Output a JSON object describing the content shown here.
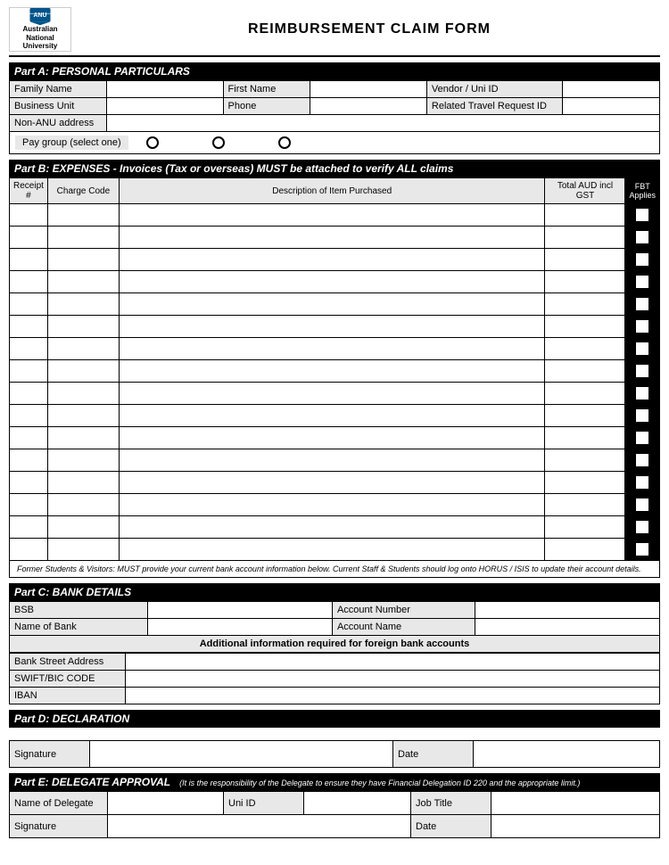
{
  "header": {
    "logo_name": "Australian National University",
    "title": "REIMBURSEMENT CLAIM FORM"
  },
  "part_a": {
    "heading": "Part A: PERSONAL PARTICULARS",
    "fields": {
      "family_name_label": "Family Name",
      "first_name_label": "First Name",
      "vendor_uni_id_label": "Vendor / Uni ID",
      "business_unit_label": "Business Unit",
      "phone_label": "Phone",
      "related_travel_label": "Related Travel Request ID",
      "non_anu_label": "Non-ANU address",
      "pay_group_label": "Pay group (select one)"
    }
  },
  "part_b": {
    "heading": "Part B: EXPENSES - Invoices (Tax or overseas) MUST be attached to verify ALL claims",
    "cols": {
      "receipt": "Receipt #",
      "charge_code": "Charge Code",
      "description": "Description of Item Purchased",
      "total_aud": "Total AUD incl GST",
      "fbt": "FBT Applies"
    },
    "rows": 16
  },
  "note": {
    "text": "Former Students & Visitors: MUST provide your current bank account information below. Current Staff & Students should log onto HORUS / ISIS to update their account details."
  },
  "part_c": {
    "heading": "Part C: BANK DETAILS",
    "bsb_label": "BSB",
    "account_number_label": "Account Number",
    "name_of_bank_label": "Name of Bank",
    "account_name_label": "Account Name",
    "foreign_info": "Additional information required for foreign bank accounts",
    "bank_street_label": "Bank Street Address",
    "swift_label": "SWIFT/BIC CODE",
    "iban_label": "IBAN"
  },
  "part_d": {
    "heading": "Part D: DECLARATION",
    "signature_label": "Signature",
    "date_label": "Date"
  },
  "part_e": {
    "heading": "Part E: DELEGATE APPROVAL",
    "note": "(It is the responsibility of the Delegate to ensure they have Financial Delegation ID 220 and the appropriate limit.)",
    "name_of_delegate_label": "Name of Delegate",
    "uni_id_label": "Uni ID",
    "job_title_label": "Job Title",
    "signature_label": "Signature",
    "date_label": "Date"
  }
}
